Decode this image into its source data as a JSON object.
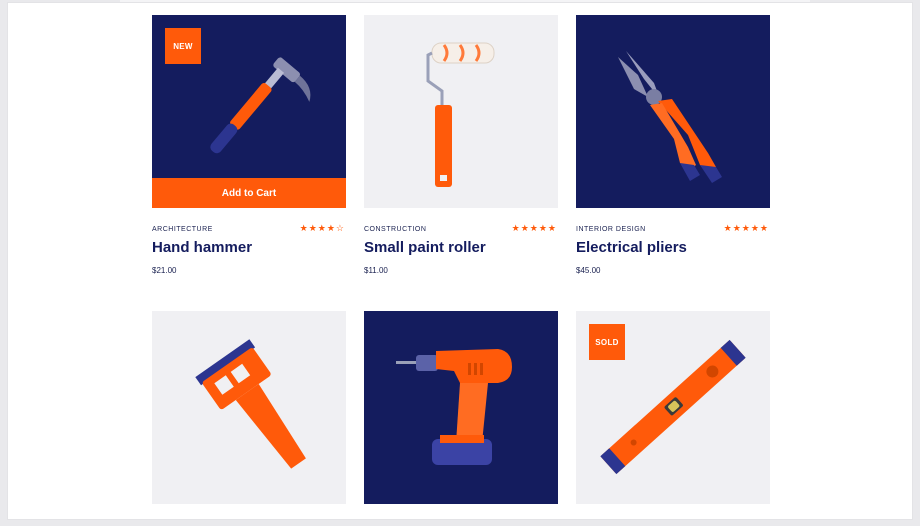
{
  "colors": {
    "accent": "#ff5a0a",
    "navy": "#141c5e",
    "light_bg": "#f0f0f3"
  },
  "products": [
    {
      "category": "ARCHITECTURE",
      "name": "Hand hammer",
      "price": "$21.00",
      "rating": 4,
      "rating_max": 5,
      "badge": "NEW",
      "cart_label": "Add to Cart",
      "icon": "hammer-icon"
    },
    {
      "category": "CONSTRUCTION",
      "name": "Small paint roller",
      "price": "$11.00",
      "rating": 5,
      "rating_max": 5,
      "icon": "paint-roller-icon"
    },
    {
      "category": "INTERIOR DESIGN",
      "name": "Electrical pliers",
      "price": "$45.00",
      "rating": 5,
      "rating_max": 5,
      "icon": "pliers-icon"
    },
    {
      "icon": "scraper-icon"
    },
    {
      "icon": "drill-icon"
    },
    {
      "badge": "SOLD",
      "icon": "spirit-level-icon"
    }
  ]
}
